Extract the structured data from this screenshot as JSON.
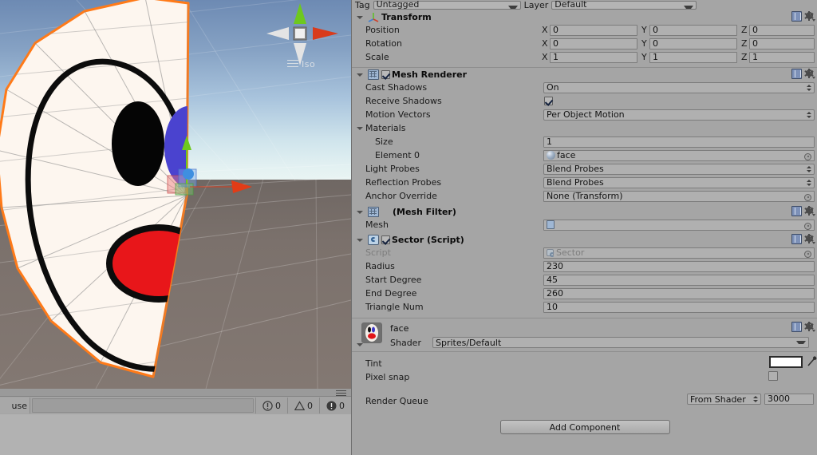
{
  "scene": {
    "gizmo": {
      "projection_label": "Iso",
      "axis_label_x": "x",
      "axis_colors": {
        "x": "#d93b1c",
        "y": "#6ec81e",
        "z": "#2f7fd6"
      }
    },
    "object": {
      "name": "face",
      "selection_outline_color": "#ff7a18",
      "body_color": "#fdf6ef",
      "mouth_color": "#e8161a",
      "eye_left_color": "#000000",
      "eye_right_color": "#4a43cf"
    },
    "sky_color": "#86a2c4",
    "ground_color": "#7b716c"
  },
  "console": {
    "pause_label": "use",
    "status_message": "",
    "error_count": "0",
    "warning_count": "0",
    "info_count": "0"
  },
  "inspector": {
    "tag": {
      "label": "Tag",
      "value": "Untagged"
    },
    "layer": {
      "label": "Layer",
      "value": "Default"
    },
    "transform": {
      "title": "Transform",
      "rows": [
        {
          "label": "Position",
          "x": "0",
          "y": "0",
          "z": "0"
        },
        {
          "label": "Rotation",
          "x": "0",
          "y": "0",
          "z": "0"
        },
        {
          "label": "Scale",
          "x": "1",
          "y": "1",
          "z": "1"
        }
      ],
      "axis_x": "X",
      "axis_y": "Y",
      "axis_z": "Z"
    },
    "mesh_renderer": {
      "title": "Mesh Renderer",
      "enabled": true,
      "cast_shadows_label": "Cast Shadows",
      "cast_shadows_value": "On",
      "receive_shadows_label": "Receive Shadows",
      "receive_shadows_checked": true,
      "motion_vectors_label": "Motion Vectors",
      "motion_vectors_value": "Per Object Motion",
      "materials_label": "Materials",
      "size_label": "Size",
      "size_value": "1",
      "element0_label": "Element 0",
      "element0_value": "face",
      "light_probes_label": "Light Probes",
      "light_probes_value": "Blend Probes",
      "reflection_probes_label": "Reflection Probes",
      "reflection_probes_value": "Blend Probes",
      "anchor_override_label": "Anchor Override",
      "anchor_override_value": "None (Transform)"
    },
    "mesh_filter": {
      "title": "(Mesh Filter)",
      "mesh_label": "Mesh",
      "mesh_value": ""
    },
    "sector_script": {
      "title": "Sector (Script)",
      "enabled": true,
      "script_label": "Script",
      "script_value": "Sector",
      "fields": [
        {
          "label": "Radius",
          "value": "230"
        },
        {
          "label": "Start Degree",
          "value": "45"
        },
        {
          "label": "End Degree",
          "value": "260"
        },
        {
          "label": "Triangle Num",
          "value": "10"
        }
      ]
    },
    "material": {
      "name": "face",
      "shader_label": "Shader",
      "shader_value": "Sprites/Default",
      "tint_label": "Tint",
      "tint_color": "#ffffff",
      "pixel_snap_label": "Pixel snap",
      "pixel_snap_checked": false,
      "render_queue_label": "Render Queue",
      "render_queue_mode": "From Shader",
      "render_queue_value": "3000"
    },
    "add_component_label": "Add Component"
  }
}
